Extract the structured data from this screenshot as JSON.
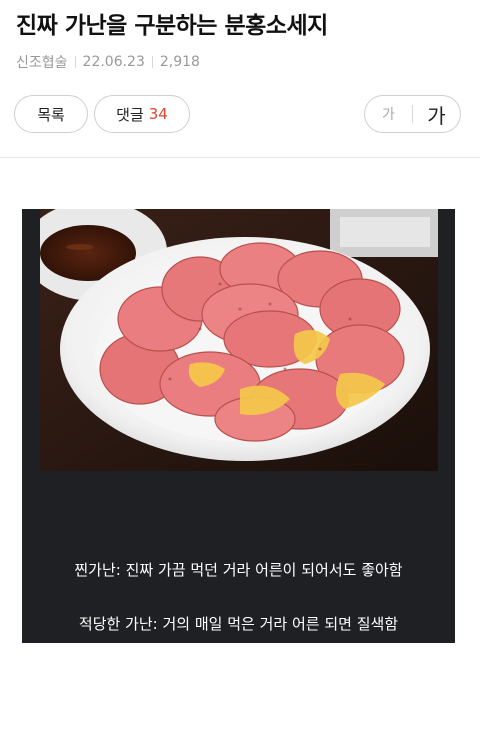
{
  "post": {
    "title": "진짜 가난을 구분하는 분홍소세지",
    "author": "신조협술",
    "date": "22.06.23",
    "views": "2,918"
  },
  "toolbar": {
    "list_label": "목록",
    "comments_label": "댓글",
    "comments_count": "34",
    "font_small_label": "가",
    "font_large_label": "가"
  },
  "image": {
    "captions": [
      "찐가난: 진짜 가끔 먹던 거라 어른이 되어서도 좋아함",
      "적당한 가난: 거의 매일 먹은 거라 어른 되면 질색함"
    ]
  },
  "colors": {
    "accent": "#e4442c",
    "card_bg": "#1f2024",
    "sausage": "#e8797a"
  }
}
